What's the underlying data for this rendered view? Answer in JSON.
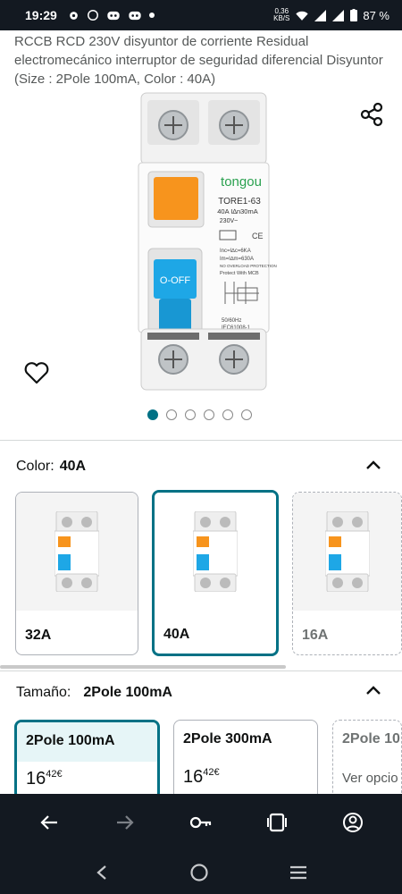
{
  "status_bar": {
    "time": "19:29",
    "net_speed_value": "0,36",
    "net_speed_unit": "KB/S",
    "battery": "87 %"
  },
  "product": {
    "title": "RCCB RCD 230V disyuntor de corriente Residual electromecánico interruptor de seguridad diferencial Disyuntor (Size : 2Pole 100mA, Color : 40A)",
    "image_dots": 6,
    "active_dot": 0,
    "device_brand": "tongou",
    "device_model": "TORE1-63",
    "device_rating": "40A I∆n30mA",
    "device_voltage": "230V~",
    "device_switch_label": "O-OFF",
    "device_spec_1": "Inc=I∆c=6KA",
    "device_spec_2": "Im=I∆m=630A",
    "device_spec_3": "NO OVERLOAD PROTECTION",
    "device_spec_4": "Protect With MCB",
    "device_freq": "50/60Hz",
    "device_standard": "IEC61008-1"
  },
  "color_section": {
    "label": "Color:",
    "value": "40A",
    "options": [
      {
        "label": "32A",
        "state": "available"
      },
      {
        "label": "40A",
        "state": "selected"
      },
      {
        "label": "16A",
        "state": "unavailable"
      }
    ]
  },
  "size_section": {
    "label": "Tamaño:",
    "value": "2Pole 100mA",
    "options": [
      {
        "label": "2Pole 100mA",
        "price_whole": "16",
        "price_fraction": "42",
        "currency": "€",
        "state": "selected"
      },
      {
        "label": "2Pole 300mA",
        "price_whole": "16",
        "price_fraction": "42",
        "currency": "€",
        "state": "available"
      },
      {
        "label": "2Pole 10",
        "more": "Ver opcio",
        "state": "unavailable"
      }
    ]
  },
  "colors": {
    "accent": "#007185",
    "dark": "#131921",
    "device_orange": "#f7941d",
    "device_blue": "#1ea7e6"
  },
  "icons": [
    "share-icon",
    "heart-icon",
    "chevron-up-icon",
    "back-arrow-icon",
    "forward-arrow-icon",
    "key-icon",
    "tabs-icon",
    "account-icon"
  ]
}
